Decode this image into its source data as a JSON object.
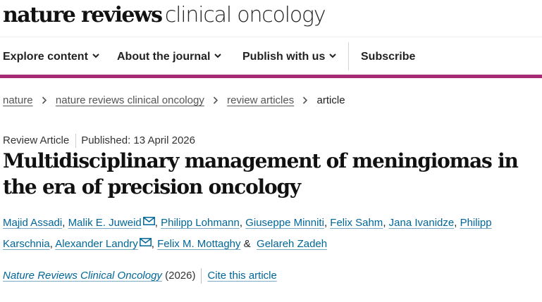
{
  "brand": {
    "name_bold": "nature reviews",
    "name_light": "clinical oncology"
  },
  "nav": {
    "items": [
      {
        "label": "Explore content",
        "has_menu": true
      },
      {
        "label": "About the journal",
        "has_menu": true
      },
      {
        "label": "Publish with us",
        "has_menu": true
      },
      {
        "label": "Subscribe",
        "has_menu": false
      }
    ]
  },
  "breadcrumb": {
    "items": [
      "nature",
      "nature reviews clinical oncology",
      "review articles"
    ],
    "current": "article"
  },
  "article": {
    "type": "Review Article",
    "published": "Published: 13 April 2026",
    "title": "Multidisciplinary management of meningiomas in the era of precision oncology",
    "authors": [
      {
        "name": "Majid Assadi",
        "sep": ", "
      },
      {
        "name": "Malik E. Juweid",
        "sep": ", "
      },
      {
        "name": "Philipp Lohmann",
        "sep": ", "
      },
      {
        "name": "Giuseppe Minniti",
        "sep": ", "
      },
      {
        "name": "Felix Sahm",
        "sep": ", "
      },
      {
        "name": "Jana Ivanidze",
        "sep": ", "
      },
      {
        "name": "Philipp Karschnia",
        "sep": ", "
      },
      {
        "name": "Alexander Landry",
        "sep": ", "
      },
      {
        "name": "Felix M. Mottaghy",
        "sep": " & "
      },
      {
        "name": "Gelareh Zadeh",
        "sep": ""
      }
    ],
    "journal": "Nature Reviews Clinical Oncology",
    "year": "(2026)",
    "cite_label": "Cite this article"
  },
  "colors": {
    "accent": "#a62a74",
    "link": "#006699"
  },
  "icons": {
    "menu": "chevron-down-icon",
    "email": "mail-icon",
    "breadcrumb": "chevron-right-icon"
  }
}
